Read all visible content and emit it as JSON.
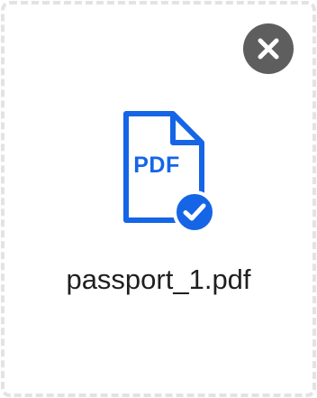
{
  "upload": {
    "file_type_label": "PDF",
    "file_name": "passport_1.pdf",
    "remove_button_label": "×",
    "icons": {
      "remove": "close-icon",
      "file": "pdf-file-icon",
      "status": "check-circle-icon"
    },
    "colors": {
      "accent": "#1565e6",
      "remove_button_bg": "#5e5e5e",
      "border": "#e3e3e3",
      "text": "#1f1f1f"
    }
  }
}
